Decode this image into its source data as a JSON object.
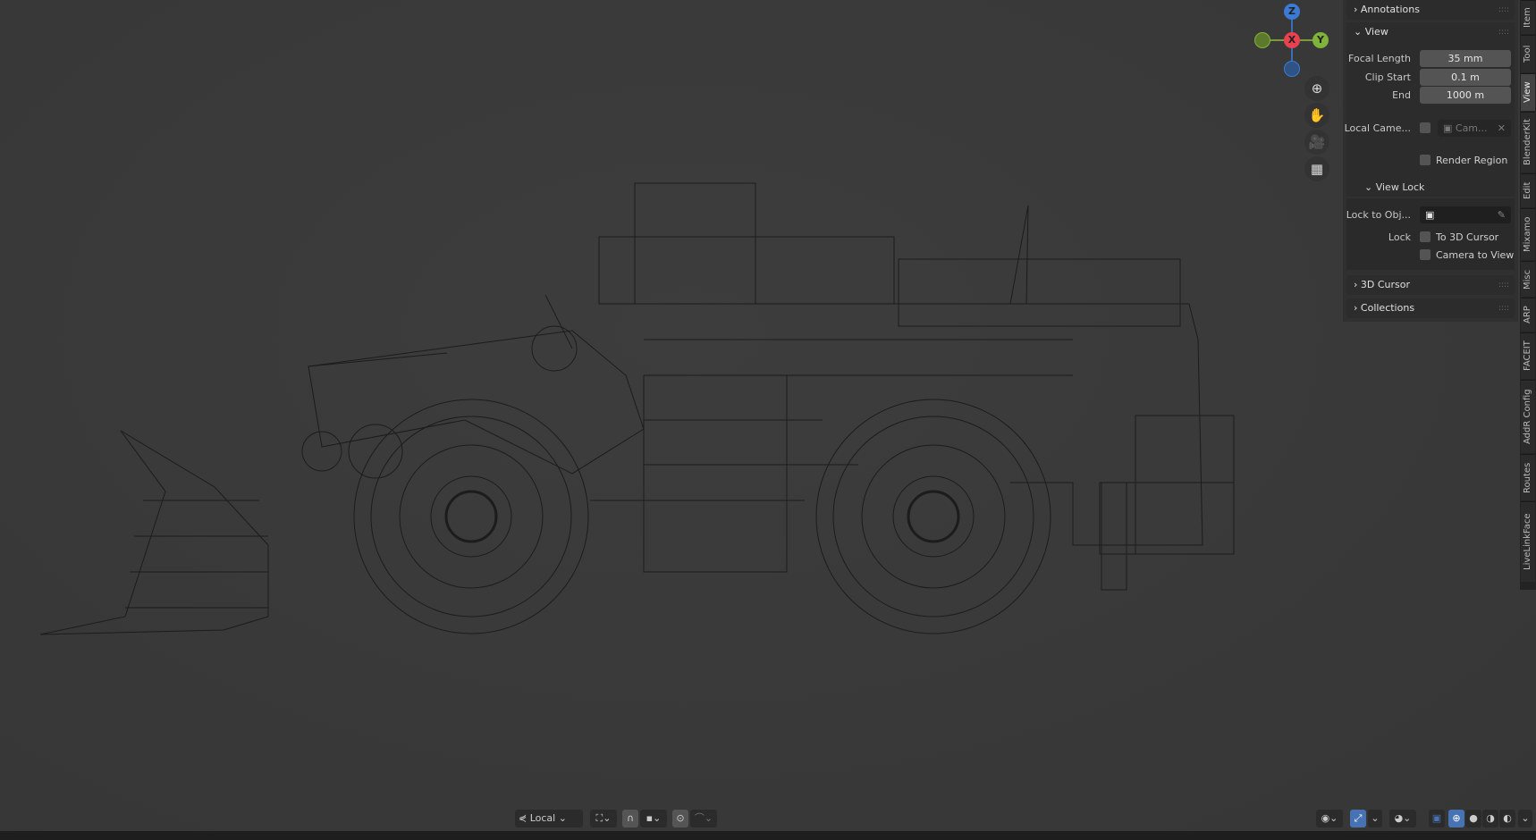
{
  "gizmo": {
    "z": "Z",
    "x": "X",
    "y": "Y",
    "colors": {
      "x": "#e8414f",
      "y": "#7fb33b",
      "z": "#3b7bd5"
    }
  },
  "nav_icons": [
    "zoom-icon",
    "hand-pan-icon",
    "camera-icon",
    "grid-icon"
  ],
  "sidebar": {
    "annotations": "Annotations",
    "view": "View",
    "focal_length_label": "Focal Length",
    "focal_length": "35 mm",
    "clip_start_label": "Clip Start",
    "clip_start": "0.1 m",
    "end_label": "End",
    "end": "1000 m",
    "local_camera_label": "Local Came...",
    "local_camera_value": "Cam...",
    "render_region": "Render Region",
    "view_lock": "View Lock",
    "lock_to_obj_label": "Lock to Obj...",
    "lock_label": "Lock",
    "to_3d_cursor": "To 3D Cursor",
    "camera_to_view": "Camera to View",
    "cursor_3d": "3D Cursor",
    "collections": "Collections"
  },
  "tabs": [
    "Item",
    "Tool",
    "View",
    "BlenderKit",
    "Edit",
    "Mixamo",
    "Misc",
    "ARP",
    "FACEIT",
    "AddR Config",
    "Routes",
    "LiveLinkFace"
  ],
  "active_tab": "View",
  "header": {
    "orientation": "Local"
  }
}
